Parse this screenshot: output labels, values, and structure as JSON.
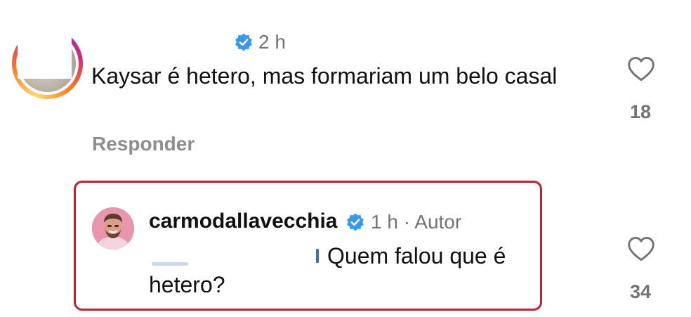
{
  "comment": {
    "time": "2 h",
    "text": "Kaysar é hetero, mas formariam um belo casal",
    "reply_label": "Responder",
    "like_count": "18",
    "verified_icon": "verified-badge-icon",
    "like_icon": "heart-outline-icon"
  },
  "reply": {
    "username": "carmodallavecchia",
    "meta": "1 h · Autor",
    "text_line1": "Quem falou que é",
    "text_line2": "hetero?",
    "like_count": "34",
    "verified_icon": "verified-badge-icon",
    "like_icon": "heart-outline-icon"
  },
  "colors": {
    "highlight_border": "#c5202d",
    "verified_blue": "#3897f0",
    "muted_text": "#737373"
  }
}
